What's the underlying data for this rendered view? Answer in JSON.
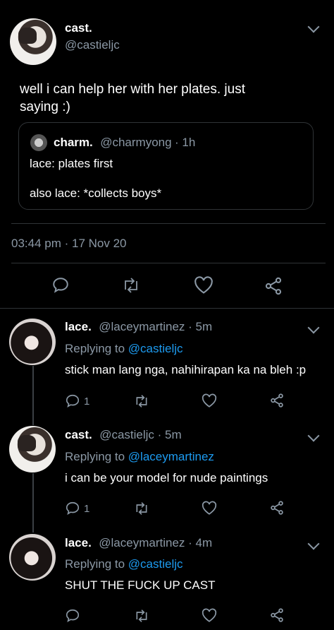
{
  "main_tweet": {
    "name": "cast.",
    "handle": "@castieljc",
    "text": "well i can help her with her plates. just saying :)",
    "quote": {
      "name": "charm.",
      "handle": "@charmyong",
      "time": "· 1h",
      "line1": "lace: plates first",
      "line2": "also lace: *collects boys*"
    },
    "timestamp": "03:44 pm · 17 Nov 20"
  },
  "replies": [
    {
      "name": "lace.",
      "meta": "@laceymartinez · 5m",
      "replying_prefix": "Replying to ",
      "replying_to": "@castieljc",
      "text": "stick man lang nga, nahihirapan ka na bleh :p",
      "reply_count": "1"
    },
    {
      "name": "cast.",
      "meta": "@castieljc · 5m",
      "replying_prefix": "Replying to ",
      "replying_to": "@laceymartinez",
      "text": "i can be your model for nude paintings",
      "reply_count": "1"
    },
    {
      "name": "lace.",
      "meta": "@laceymartinez · 4m",
      "replying_prefix": "Replying to ",
      "replying_to": "@castieljc",
      "text": "SHUT THE FUCK UP CAST",
      "reply_count": ""
    }
  ],
  "colors": {
    "background": "#000000",
    "accent": "#1d9bf0",
    "muted": "#8b98a5",
    "text": "#ffffff"
  }
}
